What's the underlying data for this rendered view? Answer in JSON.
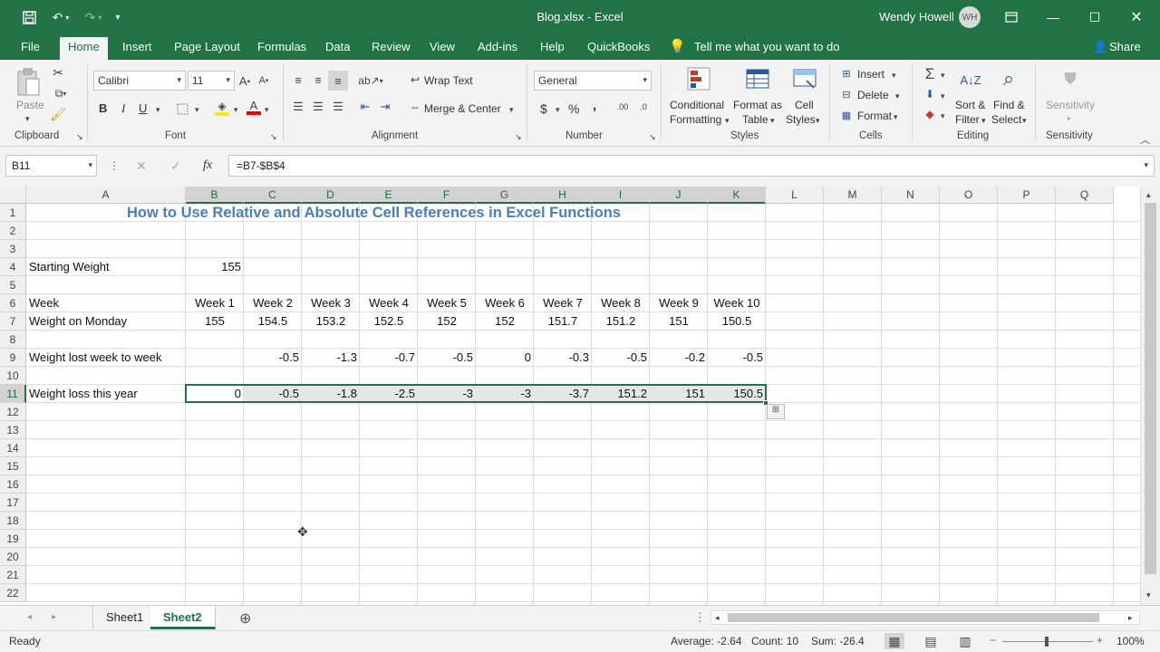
{
  "app": {
    "doc_title": "Blog.xlsx  -  Excel",
    "user_name": "Wendy Howell",
    "user_initials": "WH",
    "accent": "#217346"
  },
  "tabs": [
    "File",
    "Home",
    "Insert",
    "Page Layout",
    "Formulas",
    "Data",
    "Review",
    "View",
    "Add-ins",
    "Help",
    "QuickBooks"
  ],
  "tell_me": "Tell me what you want to do",
  "share": "Share",
  "ribbon": {
    "clipboard": {
      "paste": "Paste",
      "label": "Clipboard"
    },
    "font": {
      "name": "Calibri",
      "size": "11",
      "label": "Font",
      "bold": "B",
      "italic": "I",
      "underline": "U"
    },
    "alignment": {
      "wrap": "Wrap Text",
      "merge": "Merge & Center",
      "label": "Alignment"
    },
    "number": {
      "format": "General",
      "dollar": "$",
      "percent": "%",
      "comma": ",",
      "label": "Number"
    },
    "styles": {
      "cond": "Conditional",
      "cond2": "Formatting",
      "format_as": "Format as",
      "table": "Table",
      "cell": "Cell",
      "cell_styles": "Styles",
      "label": "Styles"
    },
    "cells": {
      "insert": "Insert",
      "delete": "Delete",
      "format": "Format",
      "label": "Cells"
    },
    "editing": {
      "sort": "Sort &",
      "filter": "Filter",
      "find": "Find &",
      "select": "Select",
      "label": "Editing"
    },
    "sensitivity": {
      "btn": "Sensitivity",
      "label": "Sensitivity"
    }
  },
  "formula_bar": {
    "name_box": "B11",
    "formula": "=B7-$B$4",
    "fx": "fx"
  },
  "columns": [
    "A",
    "B",
    "C",
    "D",
    "E",
    "F",
    "G",
    "H",
    "I",
    "J",
    "K",
    "L",
    "M",
    "N",
    "O",
    "P",
    "Q"
  ],
  "rows": [
    "1",
    "2",
    "3",
    "4",
    "5",
    "6",
    "7",
    "8",
    "9",
    "10",
    "11",
    "12",
    "13",
    "14",
    "15",
    "16",
    "17",
    "18",
    "19",
    "20",
    "21",
    "22"
  ],
  "sheet": {
    "title": "How to Use Relative and Absolute Cell References in Excel Functions",
    "starting_weight_label": "Starting Weight",
    "starting_weight_value": "155",
    "week_label": "Week",
    "weeks": [
      "Week 1",
      "Week 2",
      "Week 3",
      "Week 4",
      "Week 5",
      "Week 6",
      "Week 7",
      "Week 8",
      "Week 9",
      "Week 10"
    ],
    "monday_label": "Weight on Monday",
    "monday": [
      "155",
      "154.5",
      "153.2",
      "152.5",
      "152",
      "152",
      "151.7",
      "151.2",
      "151",
      "150.5"
    ],
    "lost_label": "Weight lost week to week",
    "lost": [
      "",
      "-0.5",
      "-1.3",
      "-0.7",
      "-0.5",
      "0",
      "-0.3",
      "-0.5",
      "-0.2",
      "-0.5"
    ],
    "year_label": "Weight loss this year",
    "year": [
      "0",
      "-0.5",
      "-1.8",
      "-2.5",
      "-3",
      "-3",
      "-3.7",
      "151.2",
      "151",
      "150.5"
    ]
  },
  "sheet_tabs": [
    "Sheet1",
    "Sheet2"
  ],
  "status": {
    "ready": "Ready",
    "average": "Average: -2.64",
    "count": "Count: 10",
    "sum": "Sum: -26.4",
    "zoom": "100%"
  }
}
